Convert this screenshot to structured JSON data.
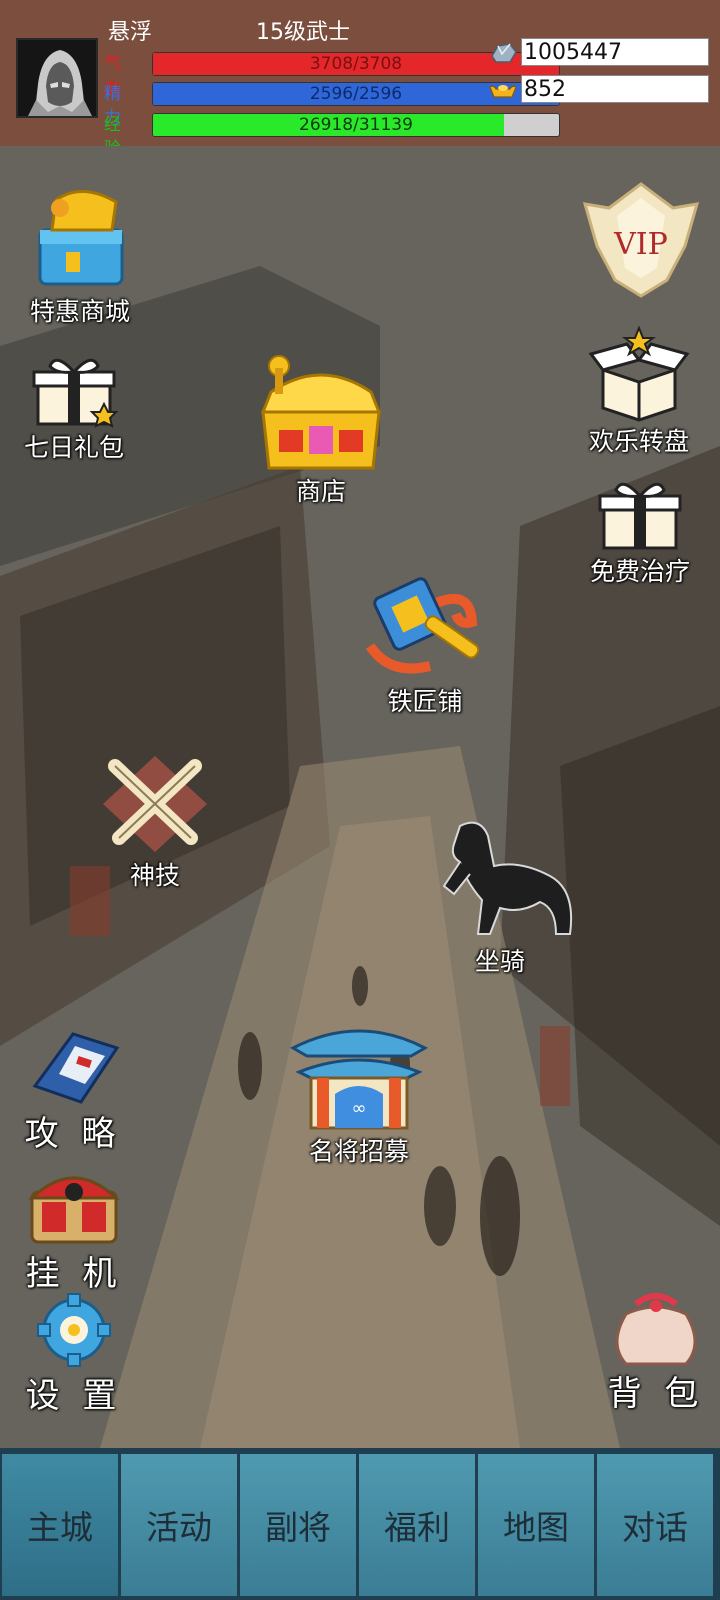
{
  "player": {
    "name": "悬浮",
    "title": "15级武士"
  },
  "stats": {
    "hp": {
      "label": "气血",
      "text": "3708/3708",
      "fraction": 1.0,
      "label_color": "#e02020",
      "bar_color": "#e3272a"
    },
    "mp": {
      "label": "精力",
      "text": "2596/2596",
      "fraction": 1.0,
      "label_color": "#3b6fe0",
      "bar_color": "#2f66d8"
    },
    "exp": {
      "label": "经验",
      "text": "26918/31139",
      "fraction": 0.8645,
      "label_color": "#19c219",
      "bar_color": "#2ae82a"
    }
  },
  "currency": {
    "silver": {
      "icon": "silver-ingot-icon",
      "value": "1005447"
    },
    "gold": {
      "icon": "gold-ingot-icon",
      "value": "852"
    }
  },
  "menu": {
    "special_shop": "特惠商城",
    "vip": "VIP",
    "seven_day_gift": "七日礼包",
    "shop": "商店",
    "lucky_wheel": "欢乐转盘",
    "free_heal": "免费治疗",
    "blacksmith": "铁匠铺",
    "divine_skill": "神技",
    "mount": "坐骑",
    "guide": "攻 略",
    "recruit": "名将招募",
    "idle": "挂 机",
    "settings": "设 置",
    "backpack": "背 包"
  },
  "nav": {
    "tabs": [
      "主城",
      "活动",
      "副将",
      "福利",
      "地图",
      "对话"
    ],
    "active_index": 0
  }
}
